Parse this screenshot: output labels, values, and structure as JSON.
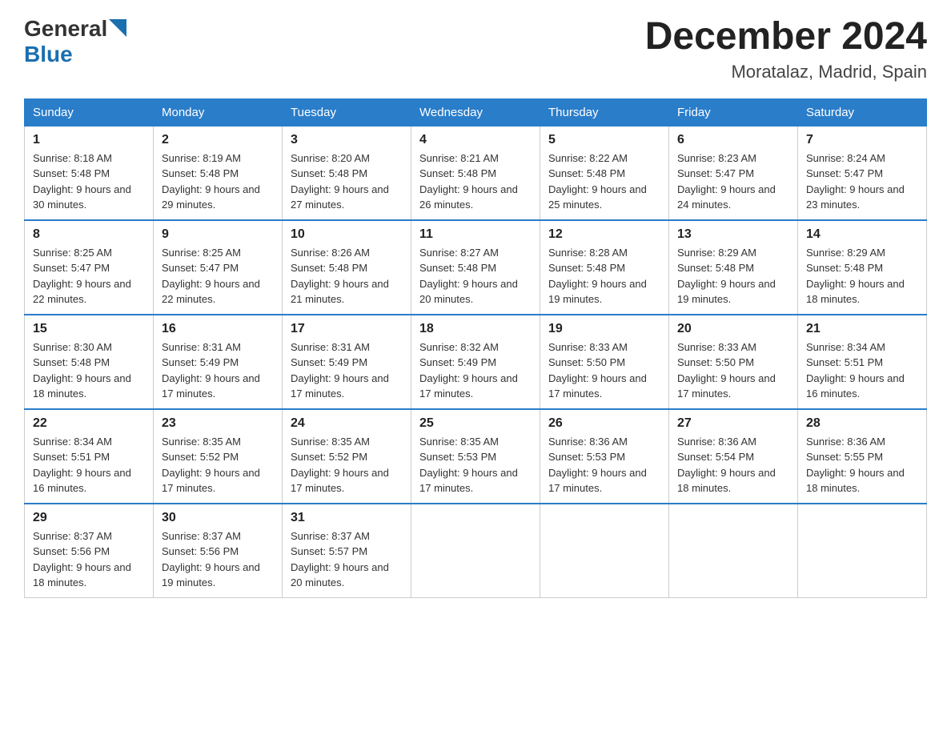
{
  "logo": {
    "general": "General",
    "blue": "Blue"
  },
  "title": "December 2024",
  "subtitle": "Moratalaz, Madrid, Spain",
  "weekdays": [
    "Sunday",
    "Monday",
    "Tuesday",
    "Wednesday",
    "Thursday",
    "Friday",
    "Saturday"
  ],
  "weeks": [
    [
      {
        "day": "1",
        "sunrise": "Sunrise: 8:18 AM",
        "sunset": "Sunset: 5:48 PM",
        "daylight": "Daylight: 9 hours and 30 minutes."
      },
      {
        "day": "2",
        "sunrise": "Sunrise: 8:19 AM",
        "sunset": "Sunset: 5:48 PM",
        "daylight": "Daylight: 9 hours and 29 minutes."
      },
      {
        "day": "3",
        "sunrise": "Sunrise: 8:20 AM",
        "sunset": "Sunset: 5:48 PM",
        "daylight": "Daylight: 9 hours and 27 minutes."
      },
      {
        "day": "4",
        "sunrise": "Sunrise: 8:21 AM",
        "sunset": "Sunset: 5:48 PM",
        "daylight": "Daylight: 9 hours and 26 minutes."
      },
      {
        "day": "5",
        "sunrise": "Sunrise: 8:22 AM",
        "sunset": "Sunset: 5:48 PM",
        "daylight": "Daylight: 9 hours and 25 minutes."
      },
      {
        "day": "6",
        "sunrise": "Sunrise: 8:23 AM",
        "sunset": "Sunset: 5:47 PM",
        "daylight": "Daylight: 9 hours and 24 minutes."
      },
      {
        "day": "7",
        "sunrise": "Sunrise: 8:24 AM",
        "sunset": "Sunset: 5:47 PM",
        "daylight": "Daylight: 9 hours and 23 minutes."
      }
    ],
    [
      {
        "day": "8",
        "sunrise": "Sunrise: 8:25 AM",
        "sunset": "Sunset: 5:47 PM",
        "daylight": "Daylight: 9 hours and 22 minutes."
      },
      {
        "day": "9",
        "sunrise": "Sunrise: 8:25 AM",
        "sunset": "Sunset: 5:47 PM",
        "daylight": "Daylight: 9 hours and 22 minutes."
      },
      {
        "day": "10",
        "sunrise": "Sunrise: 8:26 AM",
        "sunset": "Sunset: 5:48 PM",
        "daylight": "Daylight: 9 hours and 21 minutes."
      },
      {
        "day": "11",
        "sunrise": "Sunrise: 8:27 AM",
        "sunset": "Sunset: 5:48 PM",
        "daylight": "Daylight: 9 hours and 20 minutes."
      },
      {
        "day": "12",
        "sunrise": "Sunrise: 8:28 AM",
        "sunset": "Sunset: 5:48 PM",
        "daylight": "Daylight: 9 hours and 19 minutes."
      },
      {
        "day": "13",
        "sunrise": "Sunrise: 8:29 AM",
        "sunset": "Sunset: 5:48 PM",
        "daylight": "Daylight: 9 hours and 19 minutes."
      },
      {
        "day": "14",
        "sunrise": "Sunrise: 8:29 AM",
        "sunset": "Sunset: 5:48 PM",
        "daylight": "Daylight: 9 hours and 18 minutes."
      }
    ],
    [
      {
        "day": "15",
        "sunrise": "Sunrise: 8:30 AM",
        "sunset": "Sunset: 5:48 PM",
        "daylight": "Daylight: 9 hours and 18 minutes."
      },
      {
        "day": "16",
        "sunrise": "Sunrise: 8:31 AM",
        "sunset": "Sunset: 5:49 PM",
        "daylight": "Daylight: 9 hours and 17 minutes."
      },
      {
        "day": "17",
        "sunrise": "Sunrise: 8:31 AM",
        "sunset": "Sunset: 5:49 PM",
        "daylight": "Daylight: 9 hours and 17 minutes."
      },
      {
        "day": "18",
        "sunrise": "Sunrise: 8:32 AM",
        "sunset": "Sunset: 5:49 PM",
        "daylight": "Daylight: 9 hours and 17 minutes."
      },
      {
        "day": "19",
        "sunrise": "Sunrise: 8:33 AM",
        "sunset": "Sunset: 5:50 PM",
        "daylight": "Daylight: 9 hours and 17 minutes."
      },
      {
        "day": "20",
        "sunrise": "Sunrise: 8:33 AM",
        "sunset": "Sunset: 5:50 PM",
        "daylight": "Daylight: 9 hours and 17 minutes."
      },
      {
        "day": "21",
        "sunrise": "Sunrise: 8:34 AM",
        "sunset": "Sunset: 5:51 PM",
        "daylight": "Daylight: 9 hours and 16 minutes."
      }
    ],
    [
      {
        "day": "22",
        "sunrise": "Sunrise: 8:34 AM",
        "sunset": "Sunset: 5:51 PM",
        "daylight": "Daylight: 9 hours and 16 minutes."
      },
      {
        "day": "23",
        "sunrise": "Sunrise: 8:35 AM",
        "sunset": "Sunset: 5:52 PM",
        "daylight": "Daylight: 9 hours and 17 minutes."
      },
      {
        "day": "24",
        "sunrise": "Sunrise: 8:35 AM",
        "sunset": "Sunset: 5:52 PM",
        "daylight": "Daylight: 9 hours and 17 minutes."
      },
      {
        "day": "25",
        "sunrise": "Sunrise: 8:35 AM",
        "sunset": "Sunset: 5:53 PM",
        "daylight": "Daylight: 9 hours and 17 minutes."
      },
      {
        "day": "26",
        "sunrise": "Sunrise: 8:36 AM",
        "sunset": "Sunset: 5:53 PM",
        "daylight": "Daylight: 9 hours and 17 minutes."
      },
      {
        "day": "27",
        "sunrise": "Sunrise: 8:36 AM",
        "sunset": "Sunset: 5:54 PM",
        "daylight": "Daylight: 9 hours and 18 minutes."
      },
      {
        "day": "28",
        "sunrise": "Sunrise: 8:36 AM",
        "sunset": "Sunset: 5:55 PM",
        "daylight": "Daylight: 9 hours and 18 minutes."
      }
    ],
    [
      {
        "day": "29",
        "sunrise": "Sunrise: 8:37 AM",
        "sunset": "Sunset: 5:56 PM",
        "daylight": "Daylight: 9 hours and 18 minutes."
      },
      {
        "day": "30",
        "sunrise": "Sunrise: 8:37 AM",
        "sunset": "Sunset: 5:56 PM",
        "daylight": "Daylight: 9 hours and 19 minutes."
      },
      {
        "day": "31",
        "sunrise": "Sunrise: 8:37 AM",
        "sunset": "Sunset: 5:57 PM",
        "daylight": "Daylight: 9 hours and 20 minutes."
      },
      null,
      null,
      null,
      null
    ]
  ]
}
